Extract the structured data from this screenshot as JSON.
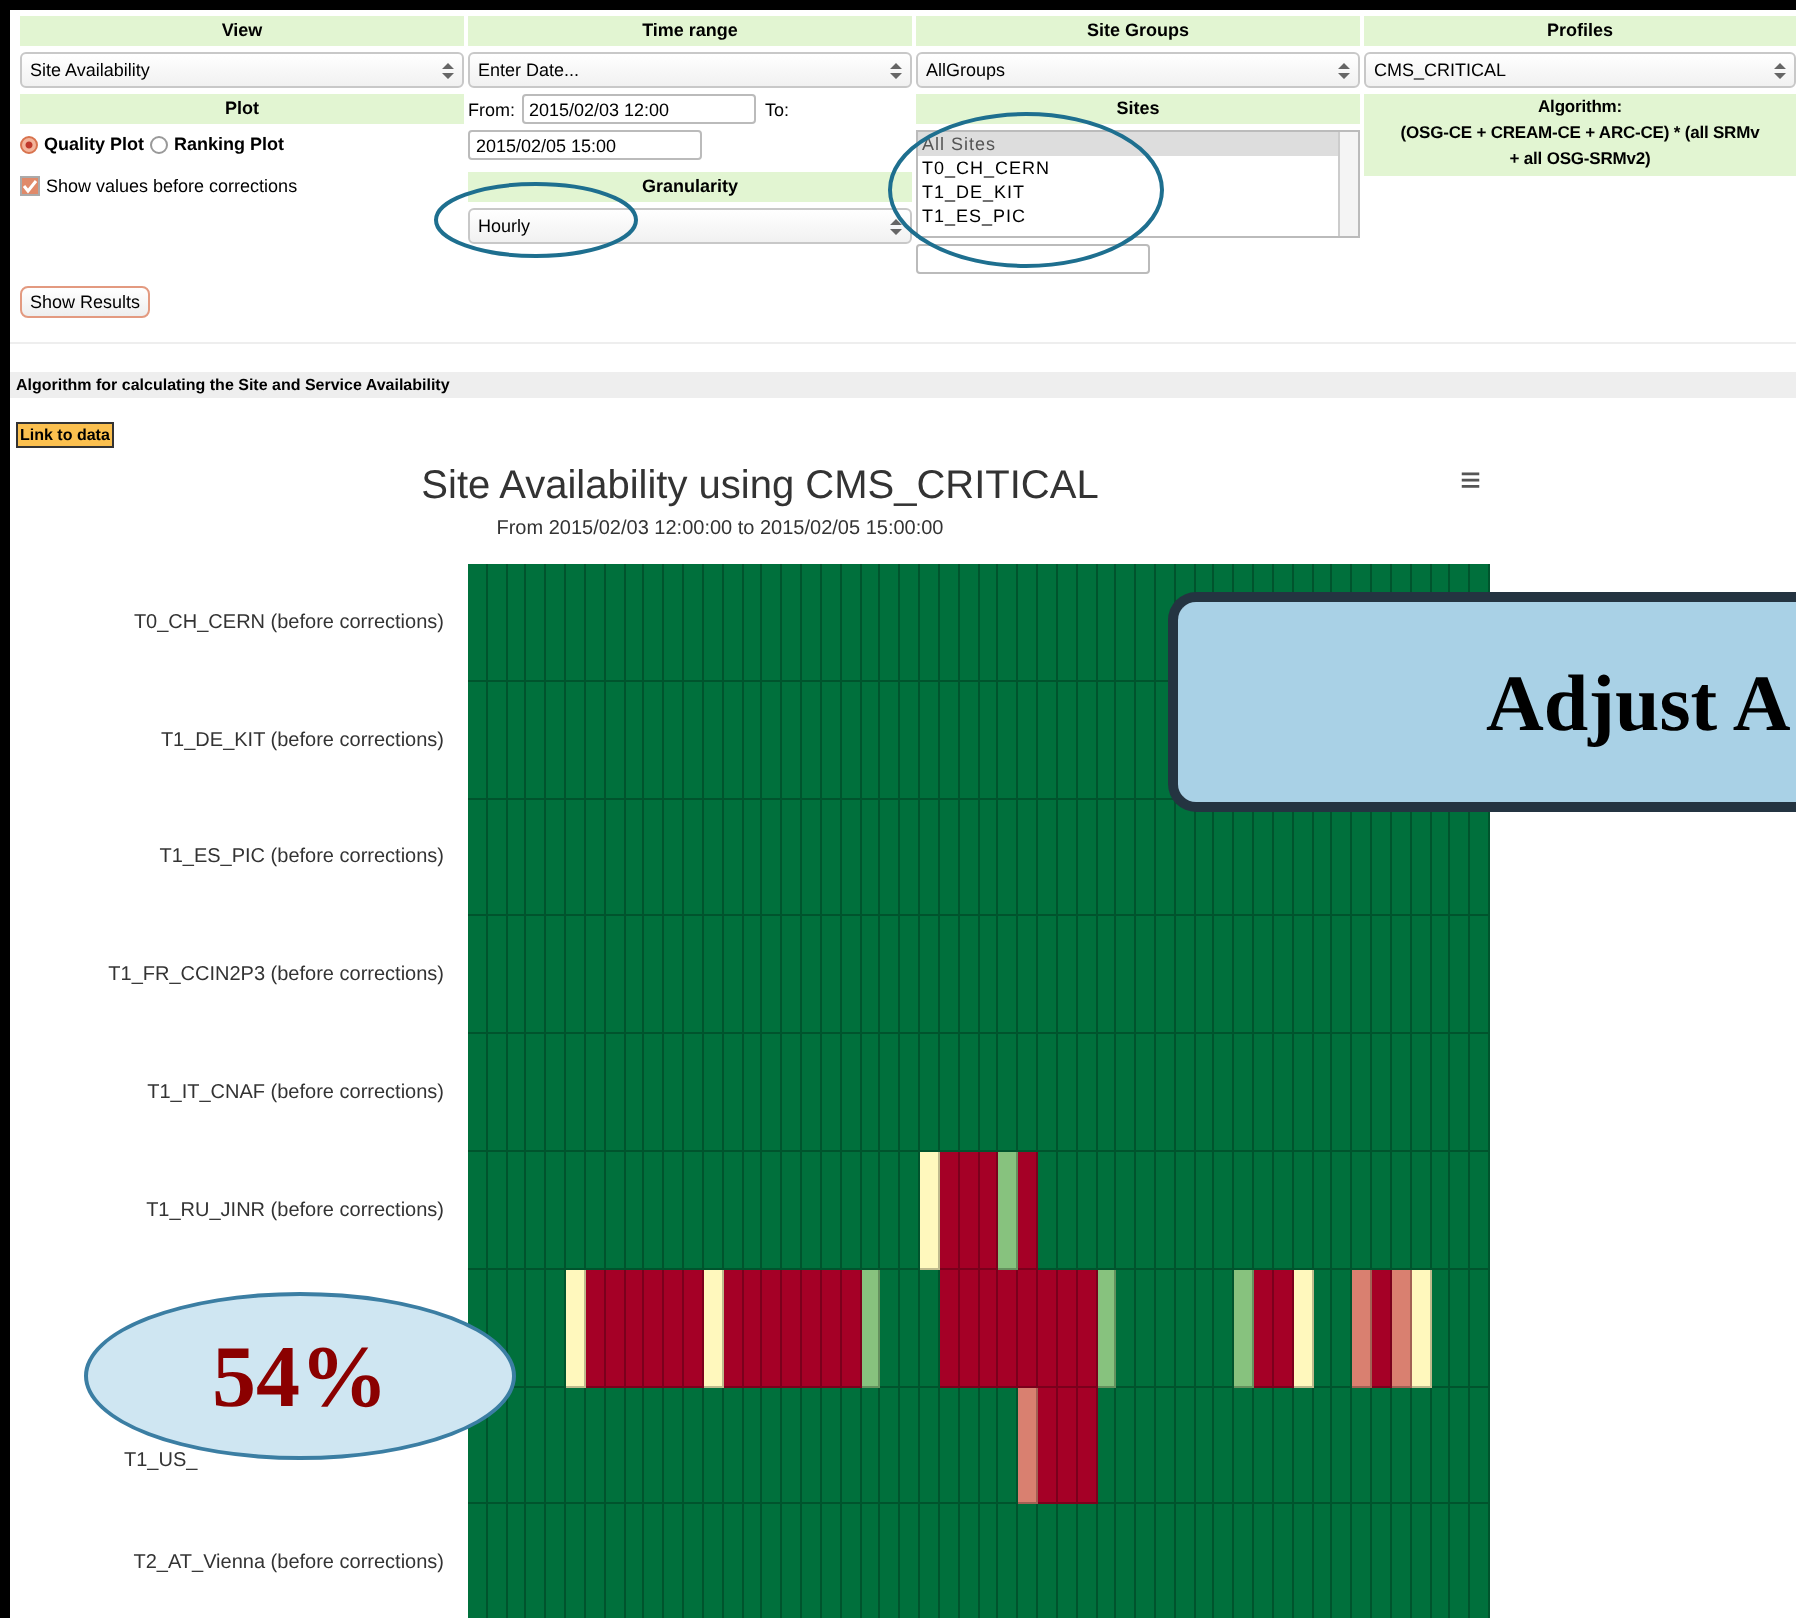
{
  "form": {
    "view": {
      "header": "View",
      "value": "Site Availability"
    },
    "plot": {
      "header": "Plot",
      "options": [
        {
          "label": "Quality Plot",
          "selected": true
        },
        {
          "label": "Ranking Plot",
          "selected": false
        }
      ],
      "show_before": {
        "label": "Show values before corrections",
        "checked": true
      }
    },
    "time_range": {
      "header": "Time range",
      "value": "Enter Date...",
      "from_label": "From:",
      "from": "2015/02/03 12:00",
      "to_label": "To:",
      "to": "2015/02/05 15:00"
    },
    "granularity": {
      "header": "Granularity",
      "value": "Hourly"
    },
    "site_groups": {
      "header": "Site Groups",
      "value": "AllGroups"
    },
    "sites": {
      "header": "Sites",
      "items": [
        {
          "label": "All Sites",
          "selected": true
        },
        {
          "label": "T0_CH_CERN",
          "selected": false
        },
        {
          "label": "T1_DE_KIT",
          "selected": false
        },
        {
          "label": "T1_ES_PIC",
          "selected": false
        }
      ]
    },
    "profiles": {
      "header": "Profiles",
      "value": "CMS_CRITICAL"
    },
    "algorithm": {
      "header": "Algorithm:",
      "text": "(OSG-CE + CREAM-CE + ARC-CE) * (all SRMv",
      "text2": "+ all OSG-SRMv2)"
    },
    "submit": "Show Results"
  },
  "algorithm_bar": "Algorithm for calculating the Site and Service Availability",
  "link_button": "Link to data",
  "chart": {
    "title": "Site Availability using CMS_CRITICAL",
    "subtitle": "From 2015/02/03 12:00:00 to 2015/02/05 15:00:00",
    "menu_glyph": "≡",
    "rows": [
      {
        "label": "T0_CH_CERN (before corrections)",
        "cells": [
          {
            "color": "#00703c"
          },
          {
            "color": "#00703c"
          },
          {
            "color": "#00703c"
          },
          {
            "color": "#00703c"
          },
          {
            "color": "#00703c"
          },
          {
            "color": "#00703c"
          },
          {
            "color": "#00703c"
          },
          {
            "color": "#00703c"
          },
          {
            "color": "#00703c"
          },
          {
            "color": "#00703c"
          },
          {
            "color": "#00703c"
          },
          {
            "color": "#00703c"
          },
          {
            "color": "#00703c"
          },
          {
            "color": "#00703c"
          },
          {
            "color": "#00703c"
          },
          {
            "color": "#00703c"
          },
          {
            "color": "#00703c"
          },
          {
            "color": "#00703c"
          },
          {
            "color": "#00703c"
          },
          {
            "color": "#00703c"
          },
          {
            "color": "#00703c"
          },
          {
            "color": "#00703c"
          },
          {
            "color": "#00703c"
          },
          {
            "color": "#00703c"
          },
          {
            "color": "#00703c"
          },
          {
            "color": "#00703c"
          },
          {
            "color": "#00703c"
          },
          {
            "color": "#00703c"
          },
          {
            "color": "#00703c"
          },
          {
            "color": "#00703c"
          },
          {
            "color": "#00703c"
          },
          {
            "color": "#00703c"
          },
          {
            "color": "#00703c"
          },
          {
            "color": "#00703c"
          },
          {
            "color": "#00703c"
          },
          {
            "color": "#00703c"
          },
          {
            "color": "#00703c"
          },
          {
            "color": "#00703c"
          },
          {
            "color": "#00703c"
          },
          {
            "color": "#00703c"
          },
          {
            "color": "#00703c"
          },
          {
            "color": "#00703c"
          },
          {
            "color": "#00703c"
          },
          {
            "color": "#00703c"
          },
          {
            "color": "#00703c"
          },
          {
            "color": "#00703c"
          },
          {
            "color": "#00703c"
          },
          {
            "color": "#00703c"
          },
          {
            "color": "#00703c"
          },
          {
            "color": "#00703c"
          },
          {
            "color": "#00703c"
          },
          {
            "color": "#00703c"
          }
        ]
      },
      {
        "label": "T1_DE_KIT (before corrections)",
        "cells": [
          {
            "color": "#00703c"
          },
          {
            "color": "#00703c"
          },
          {
            "color": "#00703c"
          },
          {
            "color": "#00703c"
          },
          {
            "color": "#00703c"
          },
          {
            "color": "#00703c"
          },
          {
            "color": "#00703c"
          },
          {
            "color": "#00703c"
          },
          {
            "color": "#00703c"
          },
          {
            "color": "#00703c"
          },
          {
            "color": "#00703c"
          },
          {
            "color": "#00703c"
          },
          {
            "color": "#00703c"
          },
          {
            "color": "#00703c"
          },
          {
            "color": "#00703c"
          },
          {
            "color": "#00703c"
          },
          {
            "color": "#00703c"
          },
          {
            "color": "#00703c"
          },
          {
            "color": "#00703c"
          },
          {
            "color": "#00703c"
          },
          {
            "color": "#00703c"
          },
          {
            "color": "#00703c"
          },
          {
            "color": "#00703c"
          },
          {
            "color": "#00703c"
          },
          {
            "color": "#00703c"
          },
          {
            "color": "#00703c"
          },
          {
            "color": "#00703c"
          },
          {
            "color": "#00703c"
          },
          {
            "color": "#00703c"
          },
          {
            "color": "#00703c"
          },
          {
            "color": "#00703c"
          },
          {
            "color": "#00703c"
          },
          {
            "color": "#00703c"
          },
          {
            "color": "#00703c"
          },
          {
            "color": "#00703c"
          },
          {
            "color": "#00703c"
          },
          {},
          {},
          {},
          {},
          {},
          {},
          {},
          {},
          {},
          {},
          {},
          {},
          {},
          {},
          {},
          {}
        ]
      },
      {
        "label": "T1_ES_PIC (before corrections)",
        "cells": [
          {
            "color": "#00703c"
          },
          {
            "color": "#00703c"
          },
          {
            "color": "#00703c"
          },
          {
            "color": "#00703c"
          },
          {
            "color": "#00703c"
          },
          {
            "color": "#00703c"
          },
          {
            "color": "#00703c"
          },
          {
            "color": "#00703c"
          },
          {
            "color": "#00703c"
          },
          {
            "color": "#00703c"
          },
          {
            "color": "#00703c"
          },
          {
            "color": "#00703c"
          },
          {
            "color": "#00703c"
          },
          {
            "color": "#00703c"
          },
          {
            "color": "#00703c"
          },
          {
            "color": "#00703c"
          },
          {
            "color": "#00703c"
          },
          {
            "color": "#00703c"
          },
          {
            "color": "#00703c"
          },
          {
            "color": "#00703c"
          },
          {
            "color": "#00703c"
          },
          {
            "color": "#00703c"
          },
          {
            "color": "#00703c"
          },
          {
            "color": "#00703c"
          },
          {
            "color": "#00703c"
          },
          {
            "color": "#00703c"
          },
          {
            "color": "#00703c"
          },
          {
            "color": "#00703c"
          },
          {
            "color": "#00703c"
          },
          {
            "color": "#00703c"
          },
          {
            "color": "#00703c"
          },
          {
            "color": "#00703c"
          },
          {
            "color": "#00703c"
          },
          {
            "color": "#00703c"
          },
          {
            "color": "#00703c"
          },
          {
            "color": "#00703c"
          },
          {
            "color": "#00703c"
          },
          {
            "color": "#00703c"
          },
          {
            "color": "#00703c"
          },
          {
            "color": "#00703c"
          },
          {
            "color": "#00703c"
          },
          {
            "color": "#00703c"
          },
          {
            "color": "#00703c"
          },
          {
            "color": "#00703c"
          },
          {
            "color": "#00703c"
          },
          {
            "color": "#00703c"
          },
          {
            "color": "#00703c"
          },
          {
            "color": "#00703c"
          },
          {
            "color": "#00703c"
          },
          {
            "color": "#00703c"
          },
          {
            "color": "#00703c"
          },
          {
            "color": "#00703c"
          }
        ]
      },
      {
        "label": "T1_FR_CCIN2P3 (before corrections)",
        "cells": [
          {
            "color": "#00703c"
          },
          {
            "color": "#00703c"
          },
          {
            "color": "#00703c"
          },
          {
            "color": "#00703c"
          },
          {
            "color": "#00703c"
          },
          {
            "color": "#00703c"
          },
          {
            "color": "#00703c"
          },
          {
            "color": "#00703c"
          },
          {
            "color": "#00703c"
          },
          {
            "color": "#00703c"
          },
          {
            "color": "#00703c"
          },
          {
            "color": "#00703c"
          },
          {
            "color": "#00703c"
          },
          {
            "color": "#00703c"
          },
          {
            "color": "#00703c"
          },
          {
            "color": "#00703c"
          },
          {
            "color": "#00703c"
          },
          {
            "color": "#00703c"
          },
          {
            "color": "#00703c"
          },
          {
            "color": "#00703c"
          },
          {
            "color": "#00703c"
          },
          {
            "color": "#00703c"
          },
          {
            "color": "#00703c"
          },
          {
            "color": "#00703c"
          },
          {
            "color": "#00703c"
          },
          {
            "color": "#00703c"
          },
          {
            "color": "#00703c"
          },
          {
            "color": "#00703c"
          },
          {
            "color": "#00703c"
          },
          {
            "color": "#00703c"
          },
          {
            "color": "#00703c"
          },
          {
            "color": "#00703c"
          },
          {
            "color": "#00703c"
          },
          {
            "color": "#00703c"
          },
          {
            "color": "#00703c"
          },
          {
            "color": "#00703c"
          },
          {
            "color": "#00703c"
          },
          {
            "color": "#00703c"
          },
          {
            "color": "#00703c"
          },
          {
            "color": "#00703c"
          },
          {
            "color": "#00703c"
          },
          {
            "color": "#00703c"
          },
          {
            "color": "#00703c"
          },
          {
            "color": "#00703c"
          },
          {
            "color": "#00703c"
          },
          {
            "color": "#00703c"
          },
          {
            "color": "#00703c"
          },
          {
            "color": "#00703c"
          },
          {
            "color": "#00703c"
          },
          {
            "color": "#00703c"
          },
          {
            "color": "#00703c"
          },
          {
            "color": "#00703c"
          }
        ]
      },
      {
        "label": "T1_IT_CNAF (before corrections)",
        "cells": [
          {
            "color": "#00703c"
          },
          {
            "color": "#00703c"
          },
          {
            "color": "#00703c"
          },
          {
            "color": "#00703c"
          },
          {
            "color": "#00703c"
          },
          {
            "color": "#00703c"
          },
          {
            "color": "#00703c"
          },
          {
            "color": "#00703c"
          },
          {
            "color": "#00703c"
          },
          {
            "color": "#00703c"
          },
          {
            "color": "#00703c"
          },
          {
            "color": "#00703c"
          },
          {
            "color": "#00703c"
          },
          {
            "color": "#00703c"
          },
          {
            "color": "#00703c"
          },
          {
            "color": "#00703c"
          },
          {
            "color": "#00703c"
          },
          {
            "color": "#00703c"
          },
          {
            "color": "#00703c"
          },
          {
            "color": "#00703c"
          },
          {
            "color": "#00703c"
          },
          {
            "color": "#00703c"
          },
          {
            "color": "#00703c"
          },
          {
            "color": "#00703c"
          },
          {
            "color": "#00703c"
          },
          {
            "color": "#00703c"
          },
          {
            "color": "#00703c"
          },
          {
            "color": "#00703c"
          },
          {
            "color": "#00703c"
          },
          {
            "color": "#00703c"
          },
          {
            "color": "#00703c"
          },
          {
            "color": "#00703c"
          },
          {
            "color": "#00703c"
          },
          {
            "color": "#00703c"
          },
          {
            "color": "#00703c"
          },
          {
            "color": "#00703c"
          },
          {
            "color": "#00703c"
          },
          {
            "color": "#00703c"
          },
          {
            "color": "#00703c"
          },
          {
            "color": "#00703c"
          },
          {
            "color": "#00703c"
          },
          {
            "color": "#00703c"
          },
          {
            "color": "#00703c"
          },
          {
            "color": "#00703c"
          },
          {
            "color": "#00703c"
          },
          {
            "color": "#00703c"
          },
          {
            "color": "#00703c"
          },
          {
            "color": "#00703c"
          },
          {
            "color": "#00703c"
          },
          {
            "color": "#00703c"
          },
          {
            "color": "#00703c"
          },
          {
            "color": "#00703c"
          }
        ]
      },
      {
        "label": "T1_RU_JINR (before corrections)",
        "cells": [
          {
            "color": "#00703c"
          },
          {
            "color": "#00703c"
          },
          {
            "color": "#00703c"
          },
          {
            "color": "#00703c"
          },
          {
            "color": "#00703c"
          },
          {
            "color": "#00703c"
          },
          {
            "color": "#00703c"
          },
          {
            "color": "#00703c"
          },
          {
            "color": "#00703c"
          },
          {
            "color": "#00703c"
          },
          {
            "color": "#00703c"
          },
          {
            "color": "#00703c"
          },
          {
            "color": "#00703c"
          },
          {
            "color": "#00703c"
          },
          {
            "color": "#00703c"
          },
          {
            "color": "#00703c"
          },
          {
            "color": "#00703c"
          },
          {
            "color": "#00703c"
          },
          {
            "color": "#00703c"
          },
          {
            "color": "#00703c"
          },
          {
            "color": "#00703c"
          },
          {
            "color": "#00703c"
          },
          {
            "color": "#00703c"
          },
          {
            "color": "#fff8bd"
          },
          {
            "color": "#a50026"
          },
          {
            "color": "#a50026"
          },
          {
            "color": "#a50026"
          },
          {
            "color": "#87c27e"
          },
          {
            "color": "#a50026"
          },
          {
            "color": "#00703c"
          },
          {
            "color": "#00703c"
          },
          {
            "color": "#00703c"
          },
          {
            "color": "#00703c"
          },
          {
            "color": "#00703c"
          },
          {
            "color": "#00703c"
          },
          {
            "color": "#00703c"
          },
          {
            "color": "#00703c"
          },
          {
            "color": "#00703c"
          },
          {
            "color": "#00703c"
          },
          {
            "color": "#00703c"
          },
          {
            "color": "#00703c"
          },
          {
            "color": "#00703c"
          },
          {
            "color": "#00703c"
          },
          {
            "color": "#00703c"
          },
          {
            "color": "#00703c"
          },
          {
            "color": "#00703c"
          },
          {
            "color": "#00703c"
          },
          {
            "color": "#00703c"
          },
          {
            "color": "#00703c"
          },
          {
            "color": "#00703c"
          },
          {
            "color": "#00703c"
          },
          {
            "color": "#00703c"
          }
        ]
      },
      {
        "cells": [
          {
            "color": "#00703c"
          },
          {
            "color": "#00703c"
          },
          {
            "color": "#00703c"
          },
          {
            "color": "#00703c"
          },
          {
            "color": "#00703c"
          },
          {
            "color": "#fff8bd"
          },
          {
            "color": "#a50026"
          },
          {
            "color": "#a50026"
          },
          {
            "color": "#a50026"
          },
          {
            "color": "#a50026"
          },
          {
            "color": "#a50026"
          },
          {
            "color": "#a50026"
          },
          {
            "color": "#fff8bd"
          },
          {
            "color": "#a50026"
          },
          {
            "color": "#a50026"
          },
          {
            "color": "#a50026"
          },
          {
            "color": "#a50026"
          },
          {
            "color": "#a50026"
          },
          {
            "color": "#a50026"
          },
          {
            "color": "#a50026"
          },
          {
            "color": "#87c27e"
          },
          {
            "color": "#00703c"
          },
          {
            "color": "#00703c"
          },
          {
            "color": "#00703c"
          },
          {
            "color": "#a50026"
          },
          {
            "color": "#a50026"
          },
          {
            "color": "#a50026"
          },
          {
            "color": "#a50026"
          },
          {
            "color": "#a50026"
          },
          {
            "color": "#a50026"
          },
          {
            "color": "#a50026"
          },
          {
            "color": "#a50026"
          },
          {
            "color": "#87c27e"
          },
          {
            "color": "#00703c"
          },
          {
            "color": "#00703c"
          },
          {
            "color": "#00703c"
          },
          {
            "color": "#00703c"
          },
          {
            "color": "#00703c"
          },
          {
            "color": "#00703c"
          },
          {
            "color": "#87c27e"
          },
          {
            "color": "#a50026"
          },
          {
            "color": "#a50026"
          },
          {
            "color": "#fff8bd"
          },
          {
            "color": "#00703c"
          },
          {
            "color": "#00703c"
          },
          {
            "color": "#d98070"
          },
          {
            "color": "#a50026"
          },
          {
            "color": "#d98070"
          },
          {
            "color": "#fff8bd"
          },
          {
            "color": "#00703c"
          },
          {
            "color": "#00703c"
          },
          {
            "color": "#00703c"
          }
        ]
      },
      {
        "label": "T1_US_",
        "kind": "partial",
        "cells": [
          {
            "color": "#00703c"
          },
          {
            "color": "#00703c"
          },
          {
            "color": "#00703c"
          },
          {
            "color": "#00703c"
          },
          {
            "color": "#00703c"
          },
          {
            "color": "#00703c"
          },
          {
            "color": "#00703c"
          },
          {
            "color": "#00703c"
          },
          {
            "color": "#00703c"
          },
          {
            "color": "#00703c"
          },
          {
            "color": "#00703c"
          },
          {
            "color": "#00703c"
          },
          {
            "color": "#00703c"
          },
          {
            "color": "#00703c"
          },
          {
            "color": "#00703c"
          },
          {
            "color": "#00703c"
          },
          {
            "color": "#00703c"
          },
          {
            "color": "#00703c"
          },
          {
            "color": "#00703c"
          },
          {
            "color": "#00703c"
          },
          {
            "color": "#00703c"
          },
          {
            "color": "#00703c"
          },
          {
            "color": "#00703c"
          },
          {
            "color": "#00703c"
          },
          {
            "color": "#00703c"
          },
          {
            "color": "#00703c"
          },
          {
            "color": "#00703c"
          },
          {
            "color": "#00703c"
          },
          {
            "color": "#d98070"
          },
          {
            "color": "#a50026"
          },
          {
            "color": "#a50026"
          },
          {
            "color": "#a50026"
          },
          {
            "color": "#00703c"
          },
          {
            "color": "#00703c"
          },
          {
            "color": "#00703c"
          },
          {
            "color": "#00703c"
          },
          {
            "color": "#00703c"
          },
          {
            "color": "#00703c"
          },
          {
            "color": "#00703c"
          },
          {
            "color": "#00703c"
          },
          {
            "color": "#00703c"
          },
          {
            "color": "#00703c"
          },
          {
            "color": "#00703c"
          },
          {
            "color": "#00703c"
          },
          {
            "color": "#00703c"
          },
          {
            "color": "#00703c"
          },
          {
            "color": "#00703c"
          },
          {
            "color": "#00703c"
          },
          {
            "color": "#00703c"
          },
          {
            "color": "#00703c"
          },
          {
            "color": "#00703c"
          },
          {
            "color": "#00703c"
          }
        ]
      },
      {
        "label": "T2_AT_Vienna (before corrections)",
        "cells": [
          {
            "color": "#00703c"
          },
          {
            "color": "#00703c"
          },
          {
            "color": "#00703c"
          },
          {
            "color": "#00703c"
          },
          {
            "color": "#00703c"
          },
          {
            "color": "#00703c"
          },
          {
            "color": "#00703c"
          },
          {
            "color": "#00703c"
          },
          {
            "color": "#00703c"
          },
          {
            "color": "#00703c"
          },
          {
            "color": "#00703c"
          },
          {
            "color": "#00703c"
          },
          {
            "color": "#00703c"
          },
          {
            "color": "#00703c"
          },
          {
            "color": "#00703c"
          },
          {
            "color": "#00703c"
          },
          {
            "color": "#00703c"
          },
          {
            "color": "#00703c"
          },
          {
            "color": "#00703c"
          },
          {
            "color": "#00703c"
          },
          {
            "color": "#00703c"
          },
          {
            "color": "#00703c"
          },
          {
            "color": "#00703c"
          },
          {
            "color": "#00703c"
          },
          {
            "color": "#00703c"
          },
          {
            "color": "#00703c"
          },
          {
            "color": "#00703c"
          },
          {
            "color": "#00703c"
          },
          {
            "color": "#00703c"
          },
          {
            "color": "#00703c"
          },
          {
            "color": "#00703c"
          },
          {
            "color": "#00703c"
          },
          {
            "color": "#00703c"
          },
          {
            "color": "#00703c"
          },
          {
            "color": "#00703c"
          },
          {
            "color": "#00703c"
          },
          {
            "color": "#00703c"
          },
          {
            "color": "#00703c"
          },
          {
            "color": "#00703c"
          },
          {
            "color": "#00703c"
          },
          {
            "color": "#00703c"
          },
          {
            "color": "#00703c"
          },
          {
            "color": "#00703c"
          },
          {
            "color": "#00703c"
          },
          {
            "color": "#00703c"
          },
          {
            "color": "#00703c"
          },
          {
            "color": "#00703c"
          },
          {
            "color": "#00703c"
          },
          {
            "color": "#00703c"
          },
          {
            "color": "#00703c"
          },
          {
            "color": "#00703c"
          },
          {
            "color": "#00703c"
          }
        ]
      }
    ]
  },
  "callouts": [
    {
      "kind": "box",
      "text": "Adjust A"
    },
    {
      "kind": "ellipse",
      "text": "54%"
    }
  ]
}
